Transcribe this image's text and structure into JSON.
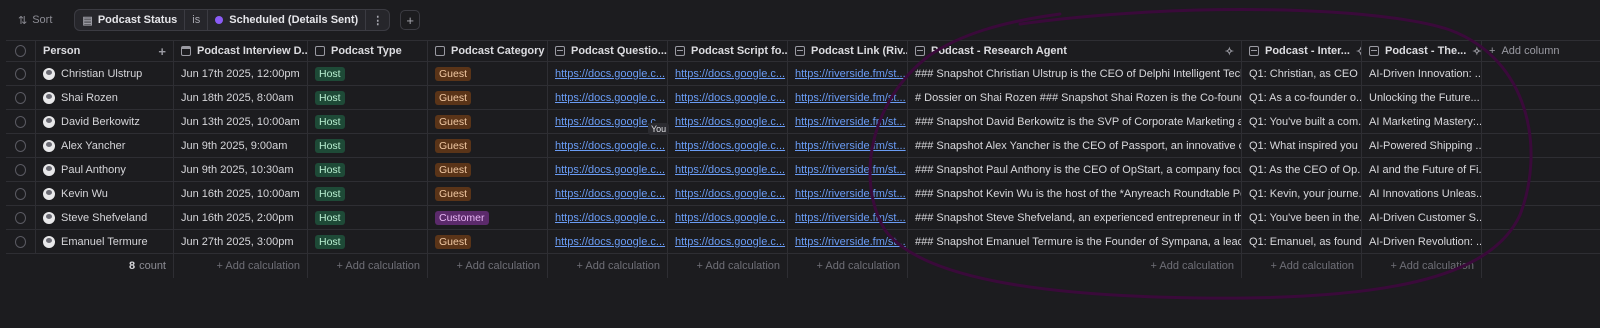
{
  "toolbar": {
    "sort_label": "Sort",
    "filter": {
      "field": "Podcast Status",
      "operator": "is",
      "value": "Scheduled (Details Sent)",
      "value_color": "#8b5cf6"
    },
    "add_filter_label": "+"
  },
  "table": {
    "headers": [
      "Person",
      "Podcast Interview D...",
      "Podcast Type",
      "Podcast Category",
      "Podcast Questio...",
      "Podcast Script fo...",
      "Podcast Link (Riv...",
      "Podcast - Research Agent",
      "Podcast - Inter...",
      "Podcast - The...",
      "Add column"
    ],
    "rows": [
      {
        "person": "Christian Ulstrup",
        "date": "Jun 17th 2025, 12:00pm",
        "type": "Host",
        "category": "Guest",
        "q": "https://docs.google.c...",
        "s": "https://docs.google.c...",
        "link": "https://riverside.fm/st...",
        "research": "### Snapshot Christian Ulstrup is the CEO of Delphi Intelligent Technolo...",
        "inter": "Q1: Christian, as CEO ...",
        "theme": "AI-Driven Innovation: ..."
      },
      {
        "person": "Shai Rozen",
        "date": "Jun 18th 2025, 8:00am",
        "type": "Host",
        "category": "Guest",
        "q": "https://docs.google.c...",
        "s": "https://docs.google.c...",
        "link": "https://riverside.fm/st...",
        "research": "# Dossier on Shai Rozen ### Snapshot Shai Rozen is the Co-founder an...",
        "inter": "Q1: As a co-founder o...",
        "theme": "Unlocking the Future..."
      },
      {
        "person": "David Berkowitz",
        "date": "Jun 13th 2025, 10:00am",
        "type": "Host",
        "category": "Guest",
        "q": "https://docs.google.c...",
        "s": "https://docs.google.c...",
        "link": "https://riverside.fm/st...",
        "research": "### Snapshot David Berkowitz is the SVP of Corporate Marketing and C...",
        "inter": "Q1: You've built a com...",
        "theme": "AI Marketing Mastery:..."
      },
      {
        "person": "Alex Yancher",
        "date": "Jun 9th 2025, 9:00am",
        "type": "Host",
        "category": "Guest",
        "q": "https://docs.google.c...",
        "s": "https://docs.google.c...",
        "link": "https://riverside.fm/st...",
        "research": "### Snapshot Alex Yancher is the CEO of Passport, an innovative comp...",
        "inter": "Q1: What inspired you ...",
        "theme": "AI-Powered Shipping ..."
      },
      {
        "person": "Paul Anthony",
        "date": "Jun 9th 2025, 10:30am",
        "type": "Host",
        "category": "Guest",
        "q": "https://docs.google.c...",
        "s": "https://docs.google.c...",
        "link": "https://riverside.fm/st...",
        "research": "### Snapshot Paul Anthony is the CEO of OpStart, a company focused ...",
        "inter": "Q1: As the CEO of Op...",
        "theme": "AI and the Future of Fi..."
      },
      {
        "person": "Kevin Wu",
        "date": "Jun 16th 2025, 10:00am",
        "type": "Host",
        "category": "Guest",
        "q": "https://docs.google.c...",
        "s": "https://docs.google.c...",
        "link": "https://riverside.fm/st...",
        "research": "### Snapshot Kevin Wu is the host of the *Anyreach Roundtable Podca...",
        "inter": "Q1: Kevin, your journe...",
        "theme": "AI Innovations Unleas..."
      },
      {
        "person": "Steve Shefveland",
        "date": "Jun 16th 2025, 2:00pm",
        "type": "Host",
        "category": "Customer",
        "q": "https://docs.google.c...",
        "s": "https://docs.google.c...",
        "link": "https://riverside.fm/st...",
        "research": "### Snapshot Steve Shefveland, an experienced entrepreneur in the cal...",
        "inter": "Q1: You've been in the...",
        "theme": "AI-Driven Customer S..."
      },
      {
        "person": "Emanuel Termure",
        "date": "Jun 27th 2025, 3:00pm",
        "type": "Host",
        "category": "Guest",
        "q": "https://docs.google.c...",
        "s": "https://docs.google.c...",
        "link": "https://riverside.fm/st...",
        "research": "### Snapshot Emanuel Termure is the Founder of Sympana, a leader in i...",
        "inter": "Q1: Emanuel, as found...",
        "theme": "AI-Driven Revolution: ..."
      }
    ],
    "footer": {
      "count_value": "8",
      "count_label": "count",
      "add_calc_label": "+ Add calculation"
    }
  },
  "cursor_tooltip": "You",
  "colors": {
    "host_tag": "#1e4a37",
    "guest_tag": "#5a3418",
    "customer_tag": "#5b2a6b",
    "link": "#6a9cf5",
    "annotation": "#3a0a3a"
  }
}
